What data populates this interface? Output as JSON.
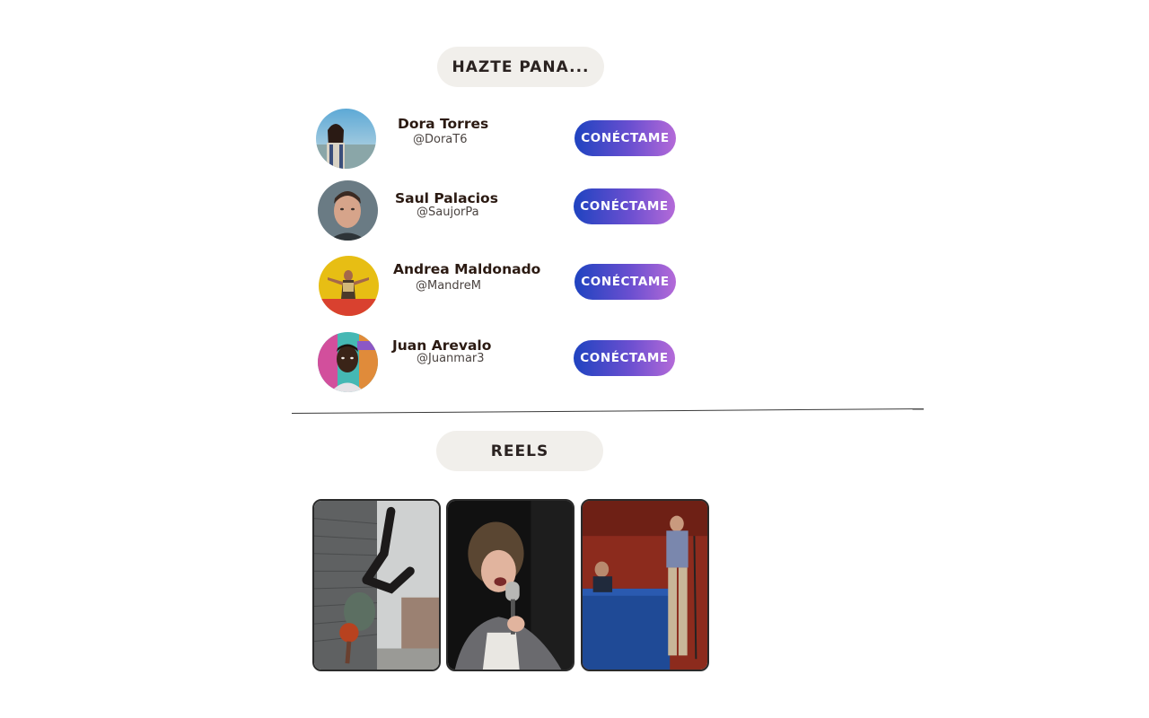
{
  "friends_section": {
    "title": "HAZTE PANA...",
    "people": [
      {
        "name": "Dora Torres",
        "handle": "@DoraT6",
        "button": "CONÉCTAME"
      },
      {
        "name": "Saul Palacios",
        "handle": "@SaujorPa",
        "button": "CONÉCTAME"
      },
      {
        "name": "Andrea Maldonado",
        "handle": "@MandreM",
        "button": "CONÉCTAME"
      },
      {
        "name": "Juan Arevalo",
        "handle": "@Juanmar3",
        "button": "CONÉCTAME"
      }
    ]
  },
  "reels_section": {
    "title": "REELS",
    "reels": [
      {
        "subject": "breakdancer"
      },
      {
        "subject": "singer"
      },
      {
        "subject": "speaker"
      }
    ]
  },
  "colors": {
    "pill_bg": "#f1efeb",
    "button_gradient_start": "#1f43c0",
    "button_gradient_end": "#b46ad8",
    "name_text": "#2b1a12"
  }
}
